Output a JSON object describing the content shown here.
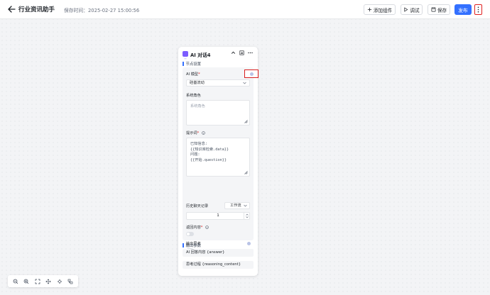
{
  "header": {
    "title": "行业资讯助手",
    "save_time": "保存时间：2025-02-27 15:00:56",
    "add_component": "添加组件",
    "debug": "调试",
    "save": "保存",
    "publish": "发布"
  },
  "node": {
    "title": "AI 对话4",
    "section_node_settings": "节点设置",
    "ai_model_label": "AI 模型",
    "ai_model_value": "硅基流动",
    "system_role_label": "系统角色",
    "system_role_placeholder": "系统角色",
    "prompt_label": "提示词",
    "prompt_lines": [
      "已知信息:",
      "{{知识库检索.data}}",
      "问题:",
      "{{开始.question}}"
    ],
    "history_label": "历史聊天记录",
    "history_select": "工作流",
    "history_count": "1",
    "return_content_label": "返回内容",
    "output_thinking_label": "输出思考",
    "section_output_params": "输出参数",
    "outputs": [
      "AI 回答内容 {answer}",
      "思考过程 {reasoning_content}"
    ]
  },
  "colors": {
    "accent": "#3370ff",
    "highlight_border": "#d81e1e",
    "node_icon": "#7c5cff"
  },
  "zoom_toolbar": [
    "zoom-out-icon",
    "zoom-in-icon",
    "fit-view-icon",
    "drag-icon",
    "move-icon",
    "auto-layout-icon"
  ]
}
